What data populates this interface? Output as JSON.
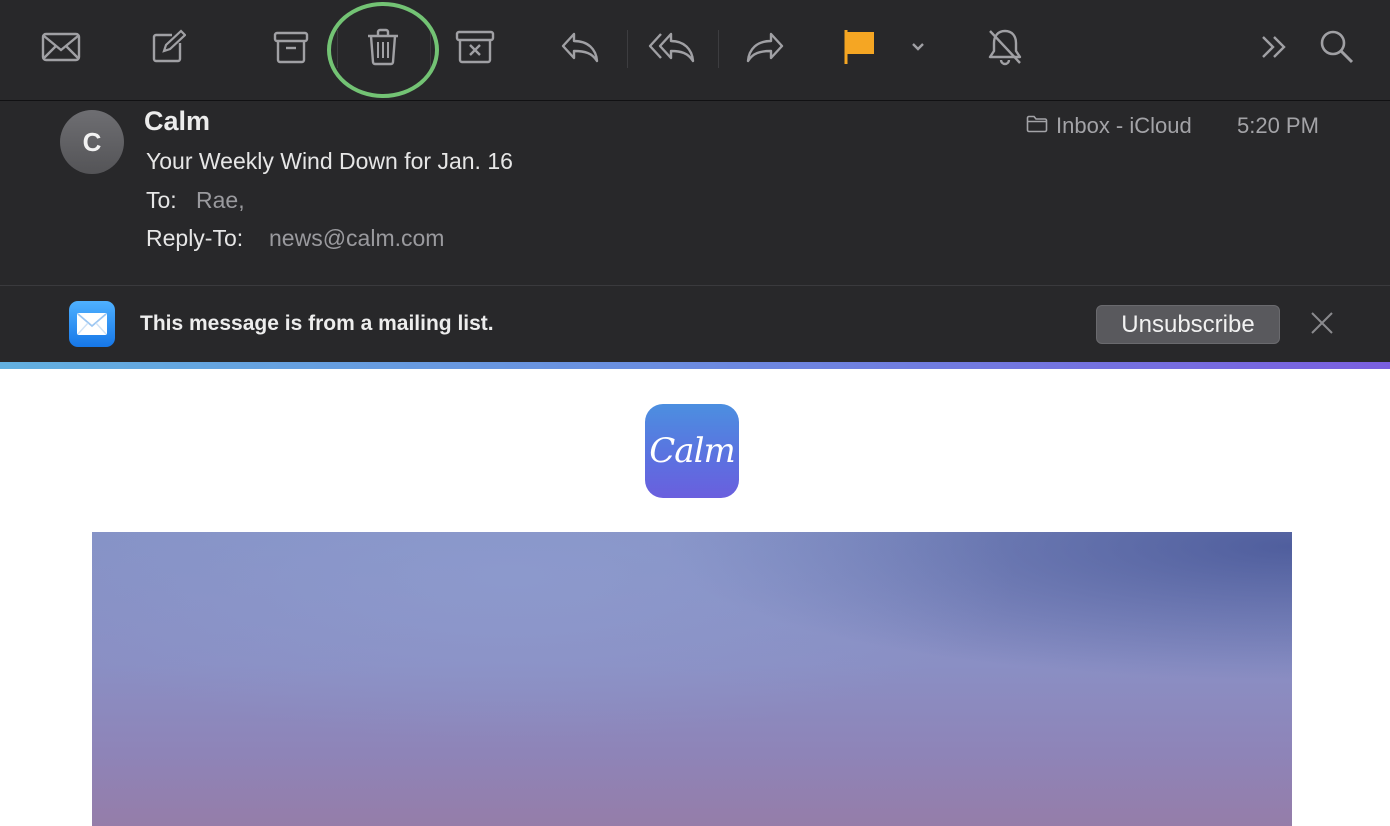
{
  "toolbar": {
    "buttons": [
      {
        "name": "get-mail",
        "icon": "envelope-icon"
      },
      {
        "name": "compose",
        "icon": "compose-icon"
      },
      {
        "name": "archive",
        "icon": "archive-icon"
      },
      {
        "name": "delete",
        "icon": "trash-icon",
        "highlighted": true
      },
      {
        "name": "junk",
        "icon": "junk-icon"
      },
      {
        "name": "reply",
        "icon": "reply-icon"
      },
      {
        "name": "reply-all",
        "icon": "reply-all-icon"
      },
      {
        "name": "forward",
        "icon": "forward-icon"
      },
      {
        "name": "flag",
        "icon": "flag-icon",
        "color": "#f5a623"
      },
      {
        "name": "flag-menu",
        "icon": "chevron-down-icon"
      },
      {
        "name": "mute",
        "icon": "bell-slash-icon"
      },
      {
        "name": "more",
        "icon": "chevron-double-right-icon"
      },
      {
        "name": "search",
        "icon": "search-icon"
      }
    ],
    "highlight_color": "#73c374"
  },
  "message": {
    "avatar_initial": "C",
    "sender": "Calm",
    "subject": "Your Weekly Wind Down for Jan. 16",
    "to_label": "To:",
    "to_value": "Rae,",
    "reply_to_label": "Reply-To:",
    "reply_to_value": "news@calm.com",
    "mailbox": "Inbox - iCloud",
    "time": "5:20 PM"
  },
  "banner": {
    "text": "This message is from a mailing list.",
    "unsubscribe_label": "Unsubscribe"
  },
  "body": {
    "logo_text": "Calm",
    "accent_color": "#5b6fe0"
  },
  "colors": {
    "toolbar_bg": "#28282a",
    "icon": "#a0a0a4",
    "flag": "#f5a623"
  }
}
